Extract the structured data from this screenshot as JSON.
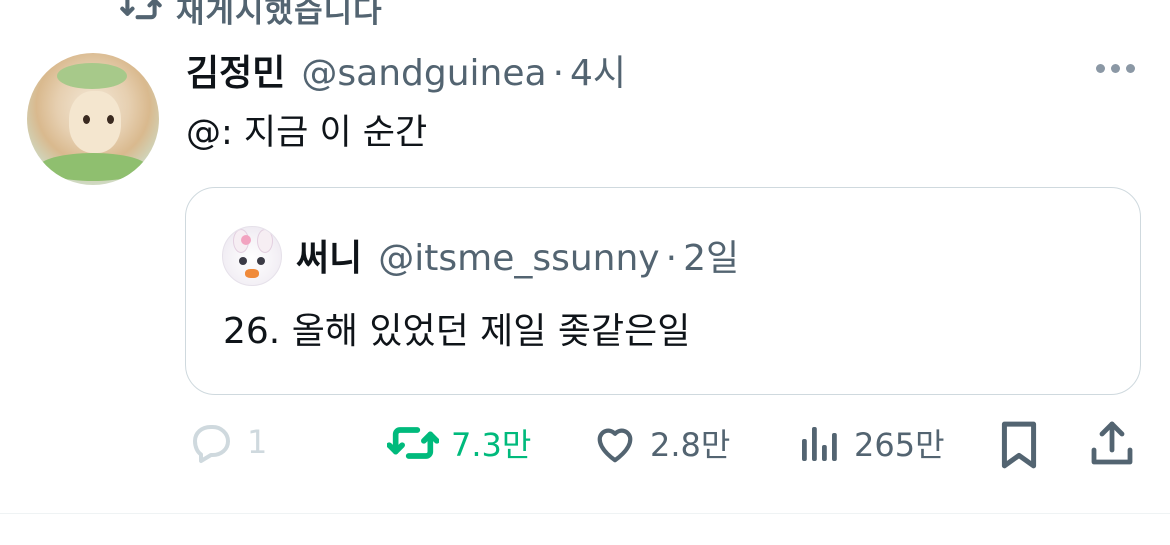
{
  "repost_header": {
    "label": "재게시했습니다"
  },
  "tweet": {
    "author_name": "김정민",
    "author_handle": "@sandguinea",
    "separator": "·",
    "time": "4시",
    "text": "@: 지금 이 순간"
  },
  "quoted_tweet": {
    "author_name": "써니",
    "author_handle": "@itsme_ssunny",
    "separator": "·",
    "time": "2일",
    "text": "26. 올해 있었던 제일 좆같은일"
  },
  "actions": {
    "reply_count": "1",
    "repost_count": "7.3만",
    "like_count": "2.8만",
    "views_count": "265만"
  },
  "colors": {
    "muted": "#536471",
    "repost_active": "#00ba7c",
    "border": "#cfd9de"
  }
}
